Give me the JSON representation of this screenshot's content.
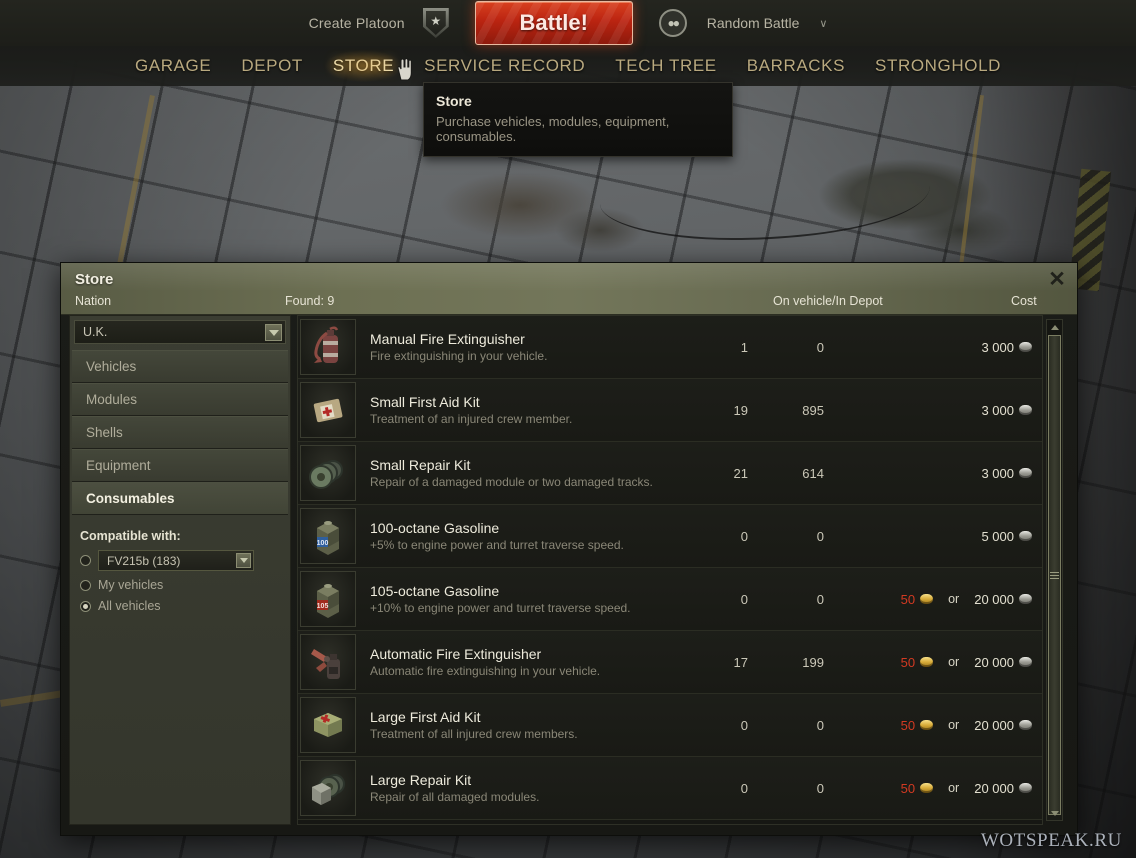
{
  "topbar": {
    "create_platoon_label": "Create Platoon",
    "platoon_icon": "platoon-shield-icon",
    "battle_label": "Battle!",
    "mode_icon": "random-battle-icon",
    "mode_label": "Random Battle",
    "mode_caret": "∨"
  },
  "nav": {
    "items": [
      {
        "label": "GARAGE",
        "active": false
      },
      {
        "label": "DEPOT",
        "active": false
      },
      {
        "label": "STORE",
        "active": true
      },
      {
        "label": "SERVICE RECORD",
        "active": false
      },
      {
        "label": "TECH TREE",
        "active": false
      },
      {
        "label": "BARRACKS",
        "active": false
      },
      {
        "label": "STRONGHOLD",
        "active": false
      }
    ]
  },
  "tooltip": {
    "title": "Store",
    "description": "Purchase vehicles, modules, equipment, consumables."
  },
  "store": {
    "title": "Store",
    "close_icon": "✕",
    "columns": {
      "nation": "Nation",
      "found": "Found: 9",
      "on_vehicle_in_depot": "On vehicle/In Depot",
      "cost": "Cost"
    },
    "sidebar": {
      "nation_value": "U.K.",
      "categories": [
        {
          "label": "Vehicles",
          "active": false
        },
        {
          "label": "Modules",
          "active": false
        },
        {
          "label": "Shells",
          "active": false
        },
        {
          "label": "Equipment",
          "active": false
        },
        {
          "label": "Consumables",
          "active": true
        }
      ],
      "compatible_label": "Compatible with:",
      "vehicle_value": "FV215b (183)",
      "options": [
        {
          "label": "",
          "selected": false
        },
        {
          "label": "My vehicles",
          "selected": false
        },
        {
          "label": "All vehicles",
          "selected": true
        }
      ]
    },
    "items": [
      {
        "icon": "fire-extinguisher-icon",
        "name": "Manual Fire Extinguisher",
        "description": "Fire extinguishing in your vehicle.",
        "on_vehicle": "1",
        "in_depot": "0",
        "gold_price": "",
        "or_label": "",
        "credit_price": "3 000"
      },
      {
        "icon": "first-aid-kit-icon",
        "name": "Small First Aid Kit",
        "description": "Treatment of an injured crew member.",
        "on_vehicle": "19",
        "in_depot": "895",
        "gold_price": "",
        "or_label": "",
        "credit_price": "3 000"
      },
      {
        "icon": "repair-kit-icon",
        "name": "Small Repair Kit",
        "description": "Repair of a damaged module or two damaged tracks.",
        "on_vehicle": "21",
        "in_depot": "614",
        "gold_price": "",
        "or_label": "",
        "credit_price": "3 000"
      },
      {
        "icon": "gasoline-100-icon",
        "name": "100-octane Gasoline",
        "description": "+5% to engine power and turret traverse speed.",
        "on_vehicle": "0",
        "in_depot": "0",
        "gold_price": "",
        "or_label": "",
        "credit_price": "5 000"
      },
      {
        "icon": "gasoline-105-icon",
        "name": "105-octane Gasoline",
        "description": "+10% to engine power and turret traverse speed.",
        "on_vehicle": "0",
        "in_depot": "0",
        "gold_price": "50",
        "or_label": "or",
        "credit_price": "20 000"
      },
      {
        "icon": "automatic-fire-extinguisher-icon",
        "name": "Automatic Fire Extinguisher",
        "description": "Automatic fire extinguishing in your vehicle.",
        "on_vehicle": "17",
        "in_depot": "199",
        "gold_price": "50",
        "or_label": "or",
        "credit_price": "20 000"
      },
      {
        "icon": "large-first-aid-kit-icon",
        "name": "Large First Aid Kit",
        "description": "Treatment of all injured crew members.",
        "on_vehicle": "0",
        "in_depot": "0",
        "gold_price": "50",
        "or_label": "or",
        "credit_price": "20 000"
      },
      {
        "icon": "large-repair-kit-icon",
        "name": "Large Repair Kit",
        "description": "Repair of all damaged modules.",
        "on_vehicle": "0",
        "in_depot": "0",
        "gold_price": "50",
        "or_label": "or",
        "credit_price": "20 000"
      }
    ]
  },
  "watermark": {
    "text": "WOTSPEAK.RU"
  },
  "colors": {
    "accent_gold": "#b9a97f",
    "accent_gold_active": "#efe2b6",
    "battle_red": "#bb2411",
    "gold_price": "#d23a22",
    "header_olive": "#6d7053"
  }
}
